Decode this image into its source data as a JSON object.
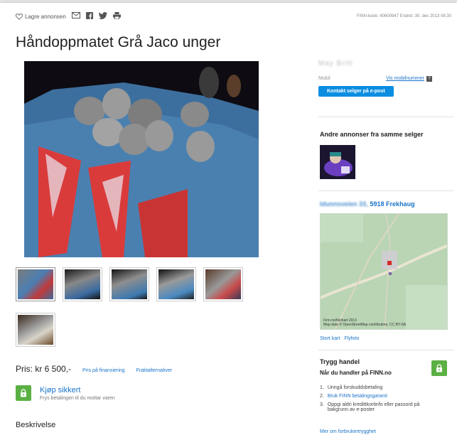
{
  "topbar": {
    "save_label": "Lagre annonsen",
    "icons": [
      "heart-outline-icon",
      "email-icon",
      "facebook-icon",
      "twitter-icon",
      "print-icon"
    ],
    "meta": "FINN-kode: 40600947   Endret: 30. des 2013 08:30"
  },
  "ad": {
    "title": "Håndoppmatet Grå Jaco unger",
    "thumbnail_count": 6
  },
  "price": {
    "label": "Pris: kr 6 500,-",
    "financing_link": "Pris på finansiering",
    "shipping_link": "Fraktalternativer"
  },
  "secure_buy": {
    "title": "Kjøp sikkert",
    "subtitle": "Frys betalingen til du mottar varen"
  },
  "description_heading": "Beskrivelse",
  "seller": {
    "name": "May Britt",
    "phone_label": "Mobil",
    "show_mobile_link": "Vis mobilnummer",
    "help_badge": "?",
    "contact_button": "Kontakt selger på e-post"
  },
  "other_ads": {
    "heading": "Andre annonser fra samme selger"
  },
  "address": {
    "street": "Idunnsveien 33,",
    "postal": "5918 Frekhaug"
  },
  "map": {
    "caption_line1": "Finn.no/Norkart 2013",
    "caption_line2": "Map data © OpenStreetMap contributors, CC BY-SA",
    "link_large": "Stort kart",
    "link_aerial": "Flyfoto"
  },
  "trygg": {
    "heading": "Trygg handel",
    "subheading": "Når du handler på FINN.no",
    "items": [
      {
        "num": "1.",
        "text": "Unngå forskuddsbetaling",
        "is_link": false
      },
      {
        "num": "2.",
        "text": "Bruk FINN betalingsgaranti",
        "is_link": true
      },
      {
        "num": "3.",
        "text": "Oppgi aldri kredittkortinfo eller passord på bakgrunn av e-poster",
        "is_link": false
      }
    ],
    "more_link": "Mer om forbrukertrygghet"
  },
  "colors": {
    "link": "#1a73c9",
    "button": "#0b8ee1",
    "secure_green": "#5bb043"
  }
}
